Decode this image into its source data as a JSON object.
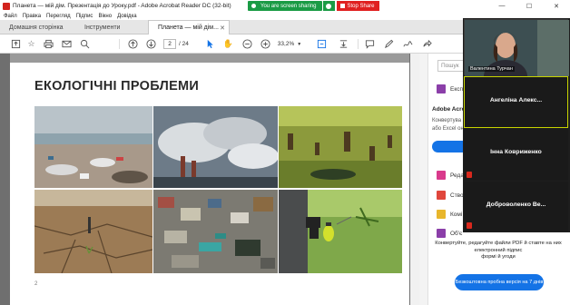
{
  "window": {
    "title": "Планета — мій дім. Презентація до Уроку.pdf - Adobe Acrobat Reader DC (32-bit)",
    "controls": [
      "—",
      "☐",
      "✕"
    ]
  },
  "sharing": {
    "status": "You are screen sharing",
    "stop_label": "Stop Share"
  },
  "menu": [
    "Файл",
    "Правка",
    "Перегляд",
    "Підпис",
    "Вікно",
    "Довідка"
  ],
  "tabs": {
    "home": "Домашня сторінка",
    "tools": "Інструменти",
    "doc": "Планета — мій дім..."
  },
  "toolbar": {
    "page_current": "2",
    "page_total": "/ 24",
    "zoom": "33,2%"
  },
  "slide": {
    "title": "ЕКОЛОГІЧНІ ПРОБЛЕМИ",
    "page_number": "2"
  },
  "right_panel": {
    "search_placeholder": "Пошук",
    "export_label": "Експ",
    "acrobat_heading": "Adobe Acrob",
    "acrobat_line1": "Конвертува",
    "acrobat_line2": "або Excel он",
    "tools": [
      "Реда",
      "Ство",
      "Комі",
      "Об'є"
    ],
    "promo_text": "Конвертуйте, редагуйте файли PDF й ставте на них електронний підпис",
    "promo_text2": "формі й угоди",
    "promo_button": "Безкоштовна пробна версія на 7 днів"
  },
  "participants": {
    "self": "Валентина Турчан",
    "p1": "Ангеліна Алекс...",
    "p2": "Інна Ковриженко",
    "p3": "Доброволенко Ве..."
  }
}
